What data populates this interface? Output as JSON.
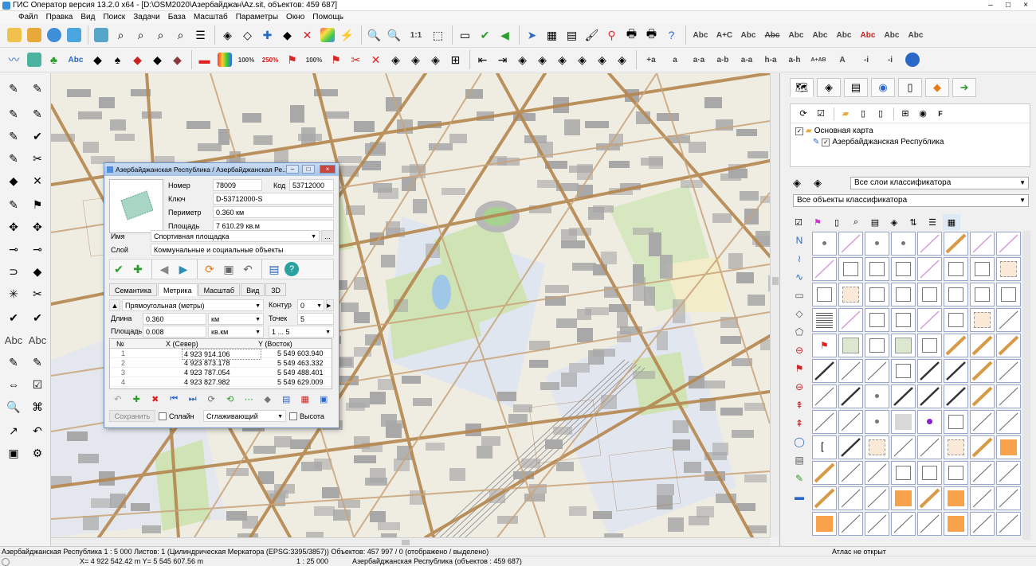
{
  "window": {
    "title": "ГИС Оператор версия 13.2.0 x64 - [D:\\OSM2020\\Азербайджан\\Az.sit, объектов: 459 687]",
    "controls": [
      "–",
      "□",
      "×"
    ]
  },
  "menu": [
    "Файл",
    "Правка",
    "Вид",
    "Поиск",
    "Задачи",
    "База",
    "Масштаб",
    "Параметры",
    "Окно",
    "Помощь"
  ],
  "toolbar1": {
    "scale_label": "1:1",
    "text_buttons": [
      "Abc",
      "A+C",
      "Abc",
      "Abc",
      "Abc",
      "Abc",
      "Abc",
      "Abc",
      "Abc",
      "Abc"
    ]
  },
  "toolbar2": {
    "text_buttons": [
      "Abc",
      "100%",
      "250%",
      "100%"
    ],
    "label_buttons": [
      "+a",
      "a",
      "a·a",
      "a-b",
      "a-a",
      "h-a",
      "a-h",
      "A+AB",
      "A",
      "-i",
      "-i"
    ]
  },
  "left_tools": {
    "text_buttons": [
      "Abc",
      "Abc"
    ]
  },
  "layers": {
    "root": "Основная карта",
    "child": "Азербайджанская Республика"
  },
  "classifier": {
    "layers_combo": "Все слои классификатора",
    "objects_combo": "Все объекты классификатора"
  },
  "dialog": {
    "title": "Азербайджанская Республика / Азербайджанская Ре...",
    "number_label": "Номер",
    "number_value": "78009",
    "code_label": "Код",
    "code_value": "53712000",
    "key_label": "Ключ",
    "key_value": "D-53712000-S",
    "perimeter_label": "Периметр",
    "perimeter_value": "0.360 км",
    "area_label": "Площадь",
    "area_value": "7 610.29 кв.м",
    "name_label": "Имя",
    "name_value": "Спортивная площадка",
    "layer_label": "Слой",
    "layer_value": "Коммунальные и социальные объекты",
    "more_button": "...",
    "tabs": [
      "Семантика",
      "Метрика",
      "Масштаб",
      "Вид",
      "3D"
    ],
    "projection": "Прямоугольная (метры)",
    "contour_label": "Контур",
    "contour_value": "0",
    "length_label": "Длина",
    "length_value": "0.360",
    "length_unit": "км",
    "points_label": "Точек",
    "points_value": "5",
    "area2_label": "Площадь",
    "area2_value": "0.008",
    "area2_unit": "кв.км",
    "range": "1 ... 5",
    "table": {
      "headers": [
        "№",
        "X (Север)",
        "Y (Восток)"
      ],
      "rows": [
        [
          "1",
          "4 923 914.106",
          "5 549 603.940"
        ],
        [
          "2",
          "4 923 873.178",
          "5 549 463.332"
        ],
        [
          "3",
          "4 923 787.054",
          "5 549 488.401"
        ],
        [
          "4",
          "4 923 827.982",
          "5 549 629.009"
        ]
      ]
    },
    "save_button": "Сохранить",
    "spline_label": "Сплайн",
    "smooth_combo": "Сглаживающий",
    "height_label": "Высота"
  },
  "status": {
    "line1": "Азербайджанская Республика  1 : 5 000  Листов: 1   (Цилиндрическая Меркатора (EPSG:3395/3857))   Объектов: 457 997 / 0 (отображено / выделено)",
    "atlas": "Атлас не открыт",
    "coords": "X= 4 922 542.42 m    Y= 5 545 607.56 m",
    "scale": "1 : 25 000",
    "objects": "Азербайджанская Республика   (объектов : 459 687)"
  },
  "colors": {
    "accent": "#3a6fc4",
    "map_road": "#b5874f",
    "map_park": "#cfe3b4",
    "map_building": "#a9a9a9"
  }
}
